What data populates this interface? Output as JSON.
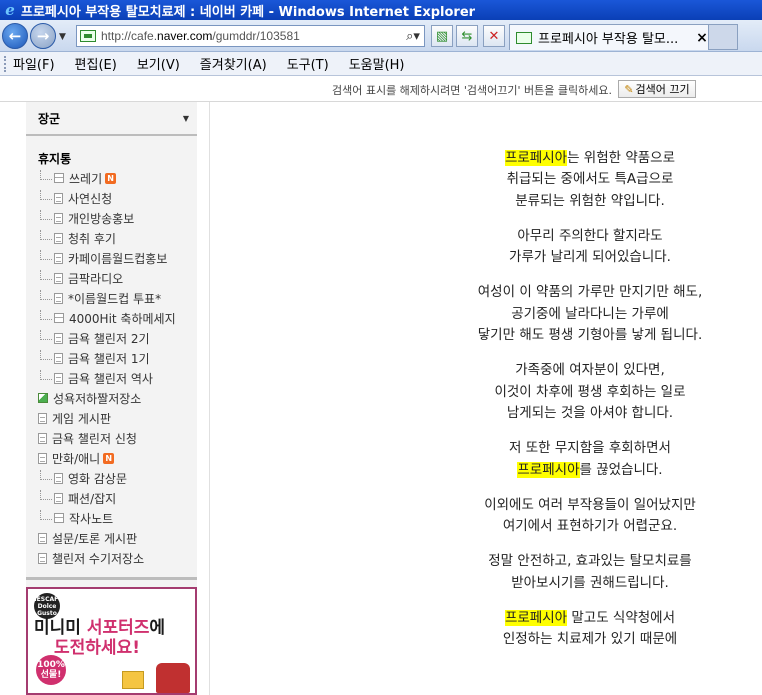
{
  "window": {
    "title": "프로페시아 부작용 탈모치료제 : 네이버 카페 - Windows Internet Explorer"
  },
  "addressbar": {
    "url_prefix": "http://cafe.",
    "url_domain": "naver.com",
    "url_path": "/gumddr/103581"
  },
  "tab": {
    "label": "프로페시아 부작용 탈모...",
    "close": "×"
  },
  "menubar": {
    "items": [
      "파일(F)",
      "편집(E)",
      "보기(V)",
      "즐겨찾기(A)",
      "도구(T)",
      "도움말(H)"
    ]
  },
  "searchbar": {
    "notice": "검색어 표시를 해제하시려면 '검색어끄기' 버튼을 클릭하세요.",
    "button": "검색어 끄기"
  },
  "sidebar": {
    "header": "장군",
    "category": "휴지통",
    "items": [
      {
        "label": "쓰레기",
        "level": "sub",
        "icon": "board",
        "badge": "N"
      },
      {
        "label": "사연신청",
        "level": "sub",
        "icon": "doc"
      },
      {
        "label": "개인방송홍보",
        "level": "sub",
        "icon": "doc"
      },
      {
        "label": "청취 후기",
        "level": "sub",
        "icon": "doc"
      },
      {
        "label": "카페이름월드컵홍보",
        "level": "sub",
        "icon": "doc"
      },
      {
        "label": "금팍라디오",
        "level": "sub",
        "icon": "doc"
      },
      {
        "label": "*이름월드컵 투표*",
        "level": "sub",
        "icon": "doc"
      },
      {
        "label": "4000Hit 축하메세지",
        "level": "sub",
        "icon": "board"
      },
      {
        "label": "금욕 챌린저 2기",
        "level": "sub",
        "icon": "doc"
      },
      {
        "label": "금욕 챌린저 1기",
        "level": "sub",
        "icon": "doc"
      },
      {
        "label": "금욕 챌린저 역사",
        "level": "sub",
        "icon": "doc"
      },
      {
        "label": "성욕저하짤저장소",
        "level": "top",
        "icon": "album"
      },
      {
        "label": "게임 게시판",
        "level": "top",
        "icon": "doc"
      },
      {
        "label": "금욕 챌린저 신청",
        "level": "top",
        "icon": "doc"
      },
      {
        "label": "만화/애니",
        "level": "top",
        "icon": "doc",
        "badge": "N"
      },
      {
        "label": "영화 감상문",
        "level": "sub",
        "icon": "doc"
      },
      {
        "label": "패션/잡지",
        "level": "sub",
        "icon": "doc"
      },
      {
        "label": "작사노트",
        "level": "sub",
        "icon": "board"
      },
      {
        "label": "설문/토론 게시판",
        "level": "top",
        "icon": "doc"
      },
      {
        "label": "챌린저 수기저장소",
        "level": "top",
        "icon": "doc"
      }
    ]
  },
  "banner": {
    "logo": "NESCAFÉ Dolce Gusto",
    "line1_a": "미니미 ",
    "line1_b": "서포터즈",
    "line1_c": "에",
    "line2": "도전하세요!",
    "gift": "100% 선물!"
  },
  "article": {
    "paragraphs": [
      [
        [
          {
            "t": "프로페시아",
            "hl": true
          },
          {
            "t": "는 위험한 약품으로"
          }
        ],
        [
          {
            "t": "취급되는 중에서도 특A급으로"
          }
        ],
        [
          {
            "t": "분류되는 위험한 약입니다."
          }
        ]
      ],
      [
        [
          {
            "t": "아무리 주의한다 할지라도"
          }
        ],
        [
          {
            "t": "가루가 날리게 되어있습니다."
          }
        ]
      ],
      [
        [
          {
            "t": "여성이 이 약품의 가루만 만지기만 해도,"
          }
        ],
        [
          {
            "t": "공기중에 날라다니는 가루에"
          }
        ],
        [
          {
            "t": "닿기만 해도 평생 기형아를 낳게 됩니다."
          }
        ]
      ],
      [
        [
          {
            "t": "가족중에 여자분이 있다면,"
          }
        ],
        [
          {
            "t": "이것이 차후에 평생 후회하는 일로"
          }
        ],
        [
          {
            "t": "남게되는 것을 아셔야 합니다."
          }
        ]
      ],
      [
        [
          {
            "t": "저 또한 무지함을 후회하면서"
          }
        ],
        [
          {
            "t": "프로페시아",
            "hl": true
          },
          {
            "t": "를 끊었습니다."
          }
        ]
      ],
      [
        [
          {
            "t": "이외에도 여러 부작용들이 일어났지만"
          }
        ],
        [
          {
            "t": "여기에서 표현하기가 어렵군요."
          }
        ]
      ],
      [
        [
          {
            "t": "정말 안전하고, 효과있는 탈모치료를"
          }
        ],
        [
          {
            "t": "받아보시기를 권해드립니다."
          }
        ]
      ],
      [
        [
          {
            "t": "프로페시아",
            "hl": true
          },
          {
            "t": " 말고도 식약청에서"
          }
        ],
        [
          {
            "t": "인정하는 치료제가 있기 때문에"
          }
        ]
      ]
    ]
  }
}
